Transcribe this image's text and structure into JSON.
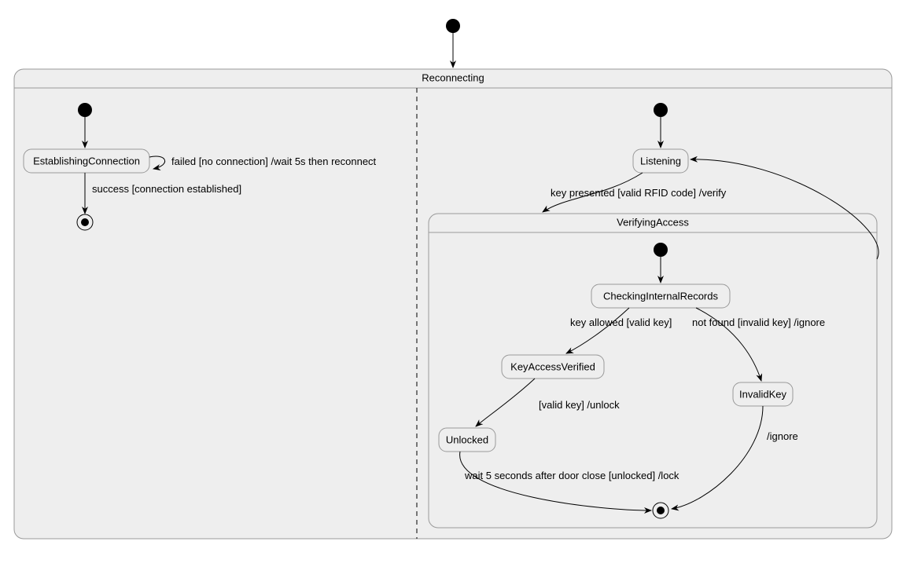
{
  "diagram": {
    "outerState": "Reconnecting",
    "leftRegion": {
      "state": "EstablishingConnection",
      "selfLoopLabel": "failed [no connection] /wait 5s then reconnect",
      "successLabel": "success [connection established]"
    },
    "rightRegion": {
      "listening": "Listening",
      "keyPresentedLabel": "key presented [valid RFID code] /verify",
      "verifyingAccess": "VerifyingAccess",
      "checking": "CheckingInternalRecords",
      "keyAllowedLabel": "key allowed [valid key]",
      "notFoundLabel": "not found [invalid key] /ignore",
      "keyAccessVerified": "KeyAccessVerified",
      "invalidKey": "InvalidKey",
      "validKeyUnlock": "[valid key] /unlock",
      "ignoreLabel": "/ignore",
      "unlocked": "Unlocked",
      "waitLockLabel": "wait 5 seconds after door close [unlocked] /lock"
    }
  }
}
